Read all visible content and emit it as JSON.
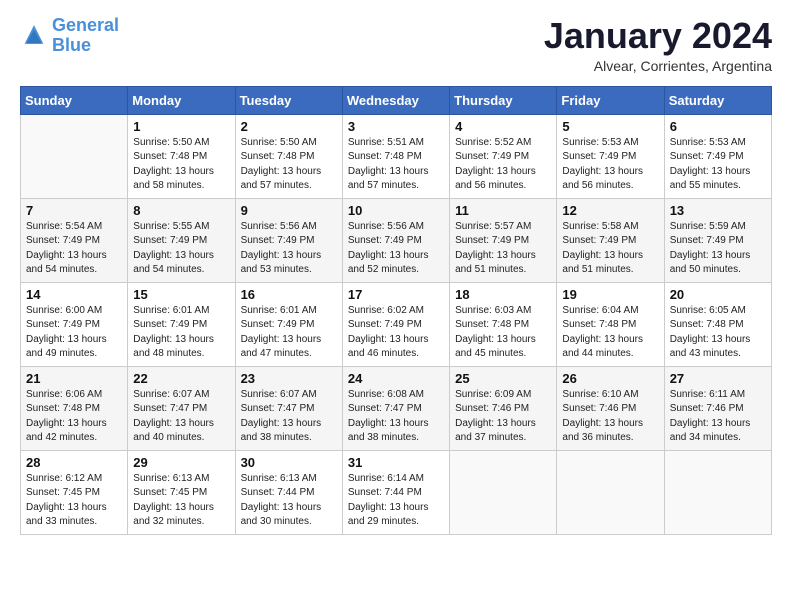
{
  "logo": {
    "text_general": "General",
    "text_blue": "Blue"
  },
  "header": {
    "month": "January 2024",
    "location": "Alvear, Corrientes, Argentina"
  },
  "weekdays": [
    "Sunday",
    "Monday",
    "Tuesday",
    "Wednesday",
    "Thursday",
    "Friday",
    "Saturday"
  ],
  "weeks": [
    [
      {
        "day": "",
        "sunrise": "",
        "sunset": "",
        "daylight": ""
      },
      {
        "day": "1",
        "sunrise": "Sunrise: 5:50 AM",
        "sunset": "Sunset: 7:48 PM",
        "daylight": "Daylight: 13 hours and 58 minutes."
      },
      {
        "day": "2",
        "sunrise": "Sunrise: 5:50 AM",
        "sunset": "Sunset: 7:48 PM",
        "daylight": "Daylight: 13 hours and 57 minutes."
      },
      {
        "day": "3",
        "sunrise": "Sunrise: 5:51 AM",
        "sunset": "Sunset: 7:48 PM",
        "daylight": "Daylight: 13 hours and 57 minutes."
      },
      {
        "day": "4",
        "sunrise": "Sunrise: 5:52 AM",
        "sunset": "Sunset: 7:49 PM",
        "daylight": "Daylight: 13 hours and 56 minutes."
      },
      {
        "day": "5",
        "sunrise": "Sunrise: 5:53 AM",
        "sunset": "Sunset: 7:49 PM",
        "daylight": "Daylight: 13 hours and 56 minutes."
      },
      {
        "day": "6",
        "sunrise": "Sunrise: 5:53 AM",
        "sunset": "Sunset: 7:49 PM",
        "daylight": "Daylight: 13 hours and 55 minutes."
      }
    ],
    [
      {
        "day": "7",
        "sunrise": "Sunrise: 5:54 AM",
        "sunset": "Sunset: 7:49 PM",
        "daylight": "Daylight: 13 hours and 54 minutes."
      },
      {
        "day": "8",
        "sunrise": "Sunrise: 5:55 AM",
        "sunset": "Sunset: 7:49 PM",
        "daylight": "Daylight: 13 hours and 54 minutes."
      },
      {
        "day": "9",
        "sunrise": "Sunrise: 5:56 AM",
        "sunset": "Sunset: 7:49 PM",
        "daylight": "Daylight: 13 hours and 53 minutes."
      },
      {
        "day": "10",
        "sunrise": "Sunrise: 5:56 AM",
        "sunset": "Sunset: 7:49 PM",
        "daylight": "Daylight: 13 hours and 52 minutes."
      },
      {
        "day": "11",
        "sunrise": "Sunrise: 5:57 AM",
        "sunset": "Sunset: 7:49 PM",
        "daylight": "Daylight: 13 hours and 51 minutes."
      },
      {
        "day": "12",
        "sunrise": "Sunrise: 5:58 AM",
        "sunset": "Sunset: 7:49 PM",
        "daylight": "Daylight: 13 hours and 51 minutes."
      },
      {
        "day": "13",
        "sunrise": "Sunrise: 5:59 AM",
        "sunset": "Sunset: 7:49 PM",
        "daylight": "Daylight: 13 hours and 50 minutes."
      }
    ],
    [
      {
        "day": "14",
        "sunrise": "Sunrise: 6:00 AM",
        "sunset": "Sunset: 7:49 PM",
        "daylight": "Daylight: 13 hours and 49 minutes."
      },
      {
        "day": "15",
        "sunrise": "Sunrise: 6:01 AM",
        "sunset": "Sunset: 7:49 PM",
        "daylight": "Daylight: 13 hours and 48 minutes."
      },
      {
        "day": "16",
        "sunrise": "Sunrise: 6:01 AM",
        "sunset": "Sunset: 7:49 PM",
        "daylight": "Daylight: 13 hours and 47 minutes."
      },
      {
        "day": "17",
        "sunrise": "Sunrise: 6:02 AM",
        "sunset": "Sunset: 7:49 PM",
        "daylight": "Daylight: 13 hours and 46 minutes."
      },
      {
        "day": "18",
        "sunrise": "Sunrise: 6:03 AM",
        "sunset": "Sunset: 7:48 PM",
        "daylight": "Daylight: 13 hours and 45 minutes."
      },
      {
        "day": "19",
        "sunrise": "Sunrise: 6:04 AM",
        "sunset": "Sunset: 7:48 PM",
        "daylight": "Daylight: 13 hours and 44 minutes."
      },
      {
        "day": "20",
        "sunrise": "Sunrise: 6:05 AM",
        "sunset": "Sunset: 7:48 PM",
        "daylight": "Daylight: 13 hours and 43 minutes."
      }
    ],
    [
      {
        "day": "21",
        "sunrise": "Sunrise: 6:06 AM",
        "sunset": "Sunset: 7:48 PM",
        "daylight": "Daylight: 13 hours and 42 minutes."
      },
      {
        "day": "22",
        "sunrise": "Sunrise: 6:07 AM",
        "sunset": "Sunset: 7:47 PM",
        "daylight": "Daylight: 13 hours and 40 minutes."
      },
      {
        "day": "23",
        "sunrise": "Sunrise: 6:07 AM",
        "sunset": "Sunset: 7:47 PM",
        "daylight": "Daylight: 13 hours and 38 minutes."
      },
      {
        "day": "24",
        "sunrise": "Sunrise: 6:08 AM",
        "sunset": "Sunset: 7:47 PM",
        "daylight": "Daylight: 13 hours and 38 minutes."
      },
      {
        "day": "25",
        "sunrise": "Sunrise: 6:09 AM",
        "sunset": "Sunset: 7:46 PM",
        "daylight": "Daylight: 13 hours and 37 minutes."
      },
      {
        "day": "26",
        "sunrise": "Sunrise: 6:10 AM",
        "sunset": "Sunset: 7:46 PM",
        "daylight": "Daylight: 13 hours and 36 minutes."
      },
      {
        "day": "27",
        "sunrise": "Sunrise: 6:11 AM",
        "sunset": "Sunset: 7:46 PM",
        "daylight": "Daylight: 13 hours and 34 minutes."
      }
    ],
    [
      {
        "day": "28",
        "sunrise": "Sunrise: 6:12 AM",
        "sunset": "Sunset: 7:45 PM",
        "daylight": "Daylight: 13 hours and 33 minutes."
      },
      {
        "day": "29",
        "sunrise": "Sunrise: 6:13 AM",
        "sunset": "Sunset: 7:45 PM",
        "daylight": "Daylight: 13 hours and 32 minutes."
      },
      {
        "day": "30",
        "sunrise": "Sunrise: 6:13 AM",
        "sunset": "Sunset: 7:44 PM",
        "daylight": "Daylight: 13 hours and 30 minutes."
      },
      {
        "day": "31",
        "sunrise": "Sunrise: 6:14 AM",
        "sunset": "Sunset: 7:44 PM",
        "daylight": "Daylight: 13 hours and 29 minutes."
      },
      {
        "day": "",
        "sunrise": "",
        "sunset": "",
        "daylight": ""
      },
      {
        "day": "",
        "sunrise": "",
        "sunset": "",
        "daylight": ""
      },
      {
        "day": "",
        "sunrise": "",
        "sunset": "",
        "daylight": ""
      }
    ]
  ]
}
